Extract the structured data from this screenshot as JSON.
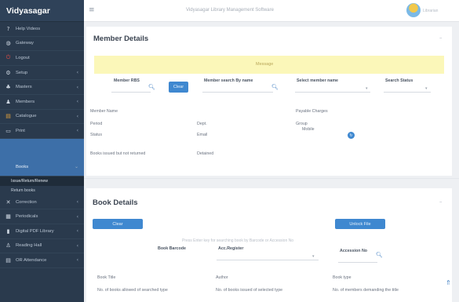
{
  "app": {
    "brand": "Vidyasagar",
    "title": "Vidyasagar Library Management Software",
    "user_name": "Librarian"
  },
  "sidebar": {
    "items": [
      {
        "label": "Help Videos",
        "icon": "question-icon"
      },
      {
        "label": "Gateway",
        "icon": "globe-icon"
      },
      {
        "label": "Logout",
        "icon": "power-icon"
      },
      {
        "label": "Setup",
        "icon": "gear-icon"
      },
      {
        "label": "Masters",
        "icon": "sitemap-icon"
      },
      {
        "label": "Members",
        "icon": "user-icon"
      },
      {
        "label": "Catalogue",
        "icon": "catalogue-icon"
      },
      {
        "label": "Print",
        "icon": "id-card-icon"
      },
      {
        "label": "Books",
        "icon": "book-icon"
      }
    ],
    "sub_items": [
      "Issue/Return/Renew",
      "Return books"
    ],
    "bottom_items": [
      {
        "label": "Correction",
        "icon": "tools-icon"
      },
      {
        "label": "Periodicals",
        "icon": "newspaper-icon"
      },
      {
        "label": "Digital PDF Library",
        "icon": "pdf-icon"
      },
      {
        "label": "Reading Hall",
        "icon": "reading-icon"
      },
      {
        "label": "OR Attendance",
        "icon": "attendance-icon"
      }
    ]
  },
  "member": {
    "title": "Member Details",
    "message": "Message",
    "member_rbs_label": "Member RBS",
    "clear_label": "Clear",
    "search_by_name_label": "Member search By name",
    "select_name_label": "Select member name",
    "search_status_label": "Search Status",
    "member_name_label": "Member Name",
    "payable_label": "Payable Charges",
    "period_label": "Period",
    "dept_label": "Dept.",
    "group_label": "Group",
    "status_label": "Status",
    "email_label": "Email",
    "mobile_label": "Mobile",
    "not_returned_label": "Books issued but not returned",
    "detained_label": "Detained"
  },
  "book": {
    "title": "Book Details",
    "clear_label": "Clear",
    "unlock_label": "Unlock File",
    "hint": "Press Enter key for searching book by Barcode or Accession No",
    "barcode_label": "Book Barcode",
    "acc_register_label": "Acc.Register",
    "accession_label": "Accession No",
    "book_title_label": "Book Title",
    "author_label": "Author",
    "book_type_label": "Book type",
    "allowed_label": "No. of books allowed of searched type",
    "issued_label": "No. of books issued of selected type",
    "demanding_label": "No. of members demanding the title"
  },
  "colors": {
    "sidebar_bg": "#2a3a4d",
    "accent": "#3f88d0",
    "message_bg": "#fbf7b9",
    "logout_red": "#e54c45"
  }
}
